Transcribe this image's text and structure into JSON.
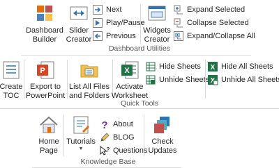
{
  "dashboard_utilities": {
    "group_label": "Dashboard Utilities",
    "dashboard_builder": [
      "Dashboard",
      "Builder"
    ],
    "slider_creator": [
      "Slider",
      "Creator"
    ],
    "next": "Next",
    "play_pause": "Play/Pause",
    "previous": "Previous",
    "widgets_creator": [
      "Widgets",
      "Creator"
    ],
    "expand_selected": "Expand Selected",
    "collapse_selected": "Collapse Selected",
    "expand_collapse_all": "Expand/Collapse All"
  },
  "quick_tools": {
    "group_label": "Quick Tools",
    "create_toc": [
      "Create",
      "TOC"
    ],
    "export_ppt": [
      "Export to",
      "PowerPoint"
    ],
    "list_files": [
      "List All Files",
      "and Folders"
    ],
    "activate_ws": [
      "Activate",
      "Worksheet"
    ],
    "hide_sheets": "Hide Sheets",
    "unhide_sheets": "Unhide Sheets",
    "hide_all": "Hide All Sheets",
    "unhide_all": "Unhide All Sheets"
  },
  "knowledge_base": {
    "group_label": "Knowledge Base",
    "home_page": [
      "Home",
      "Page"
    ],
    "tutorials": "Tutorials",
    "about": "About",
    "blog": "BLOG",
    "questions": "Questions",
    "check_updates": [
      "Check",
      "Updates"
    ]
  },
  "colors": {
    "excel_green": "#217346",
    "ppt_red": "#d24726",
    "accent_blue": "#2e75b6",
    "folder_yellow": "#f2c14e"
  }
}
